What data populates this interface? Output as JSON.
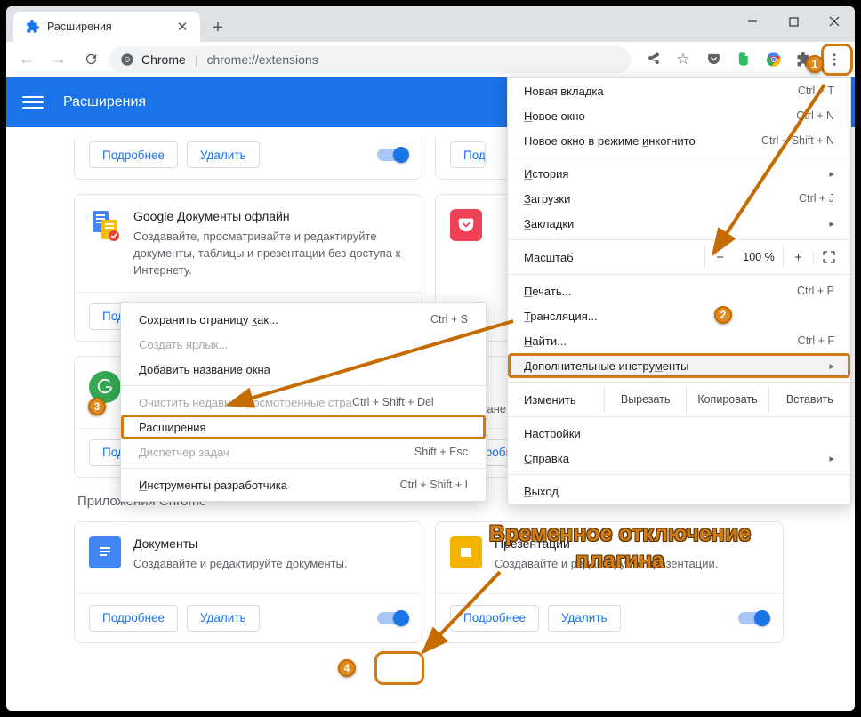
{
  "tab": {
    "title": "Расширения"
  },
  "address": {
    "site": "Chrome",
    "path": "chrome://extensions"
  },
  "appbar": {
    "title": "Расширения"
  },
  "buttons": {
    "details": "Подробнее",
    "remove": "Удалить"
  },
  "section": {
    "apps": "Приложения Chrome"
  },
  "cards": {
    "gdocs": {
      "title": "Google Документы офлайн",
      "desc": "Создавайте, просматривайте и редактируйте документы, таблицы и презентации без доступа к Интернету."
    },
    "docs": {
      "title": "Документы",
      "desc": "Создавайте и редактируйте документы."
    },
    "slides": {
      "title": "Презентации",
      "desc": "Создавайте и редактируйте презентации."
    },
    "bookmarks_tail": "сохраненными закладками."
  },
  "menu": {
    "new_tab": "Новая вкладка",
    "new_tab_s": "Ctrl + T",
    "new_win": "Новое окно",
    "new_win_s": "Ctrl + N",
    "incognito": "Новое окно в режиме инкогнито",
    "incognito_s": "Ctrl + Shift + N",
    "history": "История",
    "downloads": "Загрузки",
    "downloads_s": "Ctrl + J",
    "bookmarks": "Закладки",
    "zoom": "Масштаб",
    "zoom_pct": "100 %",
    "print": "Печать...",
    "print_s": "Ctrl + P",
    "cast": "Трансляция...",
    "find": "Найти...",
    "find_s": "Ctrl + F",
    "more_tools": "Дополнительные инструменты",
    "edit": "Изменить",
    "cut": "Вырезать",
    "copy": "Копировать",
    "paste": "Вставить",
    "settings": "Настройки",
    "help": "Справка",
    "exit": "Выход"
  },
  "submenu": {
    "save_page": "Сохранить страницу как...",
    "save_page_s": "Ctrl + S",
    "create_shortcut": "Создать ярлык...",
    "name_window": "Добавить название окна",
    "clear_browsing": "Очистить недавно просмотренные страницах...",
    "clear_browsing_s": "Ctrl + Shift + Del",
    "extensions": "Расширения",
    "task_manager": "Диспетчер задач",
    "task_manager_s": "Shift + Esc",
    "dev_tools": "Инструменты разработчика",
    "dev_tools_s": "Ctrl + Shift + I"
  },
  "annotation": {
    "text": "Временное отключение плагина"
  },
  "bubbles": {
    "b1": "1",
    "b2": "2",
    "b3": "3",
    "b4": "4"
  }
}
